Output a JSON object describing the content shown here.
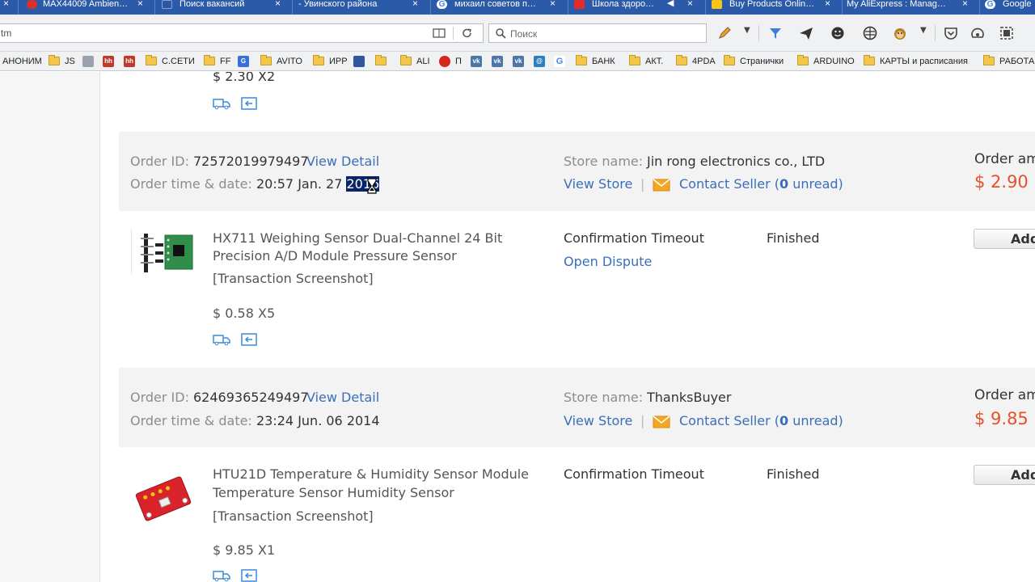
{
  "tabs": [
    {
      "title": "MAX44009 Ambien…",
      "icon_color": "#d9302b"
    },
    {
      "title": "Поиск вакансий",
      "icon_color": "#2d58a0"
    },
    {
      "title": "- Увинского района",
      "icon_color": ""
    },
    {
      "title": "михаил советов п…",
      "icon_color": "#ffffff"
    },
    {
      "title": "Школа здоро…",
      "icon_color": "#e52d27"
    },
    {
      "title": "Buy Products Onlin…",
      "icon_color": "#f5c518"
    },
    {
      "title": "My AliExpress : Manag…",
      "icon_color": ""
    },
    {
      "title": "Google",
      "icon_color": "#ffffff"
    }
  ],
  "tab_close_glyph": "×",
  "address": {
    "url_fragment": "tm",
    "search_placeholder": "Поиск"
  },
  "bookmarks": [
    {
      "label": "АНОНИМ",
      "kind": "text"
    },
    {
      "label": "JS",
      "kind": "folder"
    },
    {
      "label": "",
      "kind": "icon",
      "color": "#9aa3ad"
    },
    {
      "label": "",
      "kind": "icon",
      "color": "#c0392b",
      "glyph": "hh"
    },
    {
      "label": "",
      "kind": "icon",
      "color": "#c0392b",
      "glyph": "hh"
    },
    {
      "label": "С.СЕТИ",
      "kind": "folder"
    },
    {
      "label": "FF",
      "kind": "folder"
    },
    {
      "label": "",
      "kind": "icon",
      "color": "#3a6fd8",
      "glyph": "G"
    },
    {
      "label": "AVITO",
      "kind": "folder"
    },
    {
      "label": "ИРР",
      "kind": "folder"
    },
    {
      "label": "",
      "kind": "icon",
      "color": "#2d58a0"
    },
    {
      "label": "",
      "kind": "folder"
    },
    {
      "label": "ALI",
      "kind": "folder"
    },
    {
      "label": "П",
      "kind": "icon",
      "color": "#d7261e"
    },
    {
      "label": "",
      "kind": "icon",
      "color": "#4a76a8",
      "glyph": "vk"
    },
    {
      "label": "",
      "kind": "icon",
      "color": "#4a76a8",
      "glyph": "vk"
    },
    {
      "label": "",
      "kind": "icon",
      "color": "#4a76a8",
      "glyph": "vk"
    },
    {
      "label": "",
      "kind": "icon",
      "color": "#2a7fbf",
      "glyph": "@"
    },
    {
      "label": "",
      "kind": "icon",
      "color": "#ffffff",
      "glyph": "G"
    },
    {
      "label": "БАНК",
      "kind": "folder"
    },
    {
      "label": "АКТ.",
      "kind": "folder"
    },
    {
      "label": "4PDA",
      "kind": "folder"
    },
    {
      "label": "Странички",
      "kind": "folder"
    },
    {
      "label": "ARDUINO",
      "kind": "folder"
    },
    {
      "label": "КАРТЫ и расписания",
      "kind": "folder"
    },
    {
      "label": "РАБОТА",
      "kind": "folder"
    }
  ],
  "top_row": {
    "price": "$ 2.30 X2"
  },
  "orders": [
    {
      "id_label": "Order ID:",
      "id": "72572019979497",
      "view_detail": "View Detail",
      "time_label": "Order time & date:",
      "time_before": "20:57 Jan. 27 ",
      "time_selected": "2016",
      "store_label": "Store name:",
      "store": "Jin rong electronics co., LTD",
      "view_store": "View Store",
      "sep": "|",
      "contact_prefix": "Contact Seller (",
      "unread_count": "0",
      "contact_suffix": " unread)",
      "amount_label": "Order am",
      "amount": "$ 2.90",
      "item": {
        "title_line1": "HX711 Weighing Sensor Dual-Channel 24 Bit",
        "title_line2": "Precision A/D Module Pressure Sensor",
        "snapshot": "[Transaction Screenshot]",
        "price": "$ 0.58 X5",
        "status": "Confirmation Timeout",
        "dispute": "Open Dispute",
        "result": "Finished",
        "button": "Add"
      }
    },
    {
      "id_label": "Order ID:",
      "id": "62469365249497",
      "view_detail": "View Detail",
      "time_label": "Order time & date:",
      "time_before": "23:24 Jun. 06 2014",
      "time_selected": "",
      "store_label": "Store name:",
      "store": "ThanksBuyer",
      "view_store": "View Store",
      "sep": "|",
      "contact_prefix": "Contact Seller (",
      "unread_count": "0",
      "contact_suffix": " unread)",
      "amount_label": "Order am",
      "amount": "$ 9.85",
      "item": {
        "title_line1": "HTU21D Temperature & Humidity Sensor Module",
        "title_line2": "Temperature Sensor Humidity Sensor",
        "snapshot": "[Transaction Screenshot]",
        "price": "$ 9.85 X1",
        "status": "Confirmation Timeout",
        "dispute": "",
        "result": "Finished",
        "button": "Add"
      }
    }
  ],
  "colors": {
    "link": "#3a6fb8",
    "price": "#e4512b",
    "selection": "#0a246a",
    "tabstrip": "#2b5aa8"
  }
}
